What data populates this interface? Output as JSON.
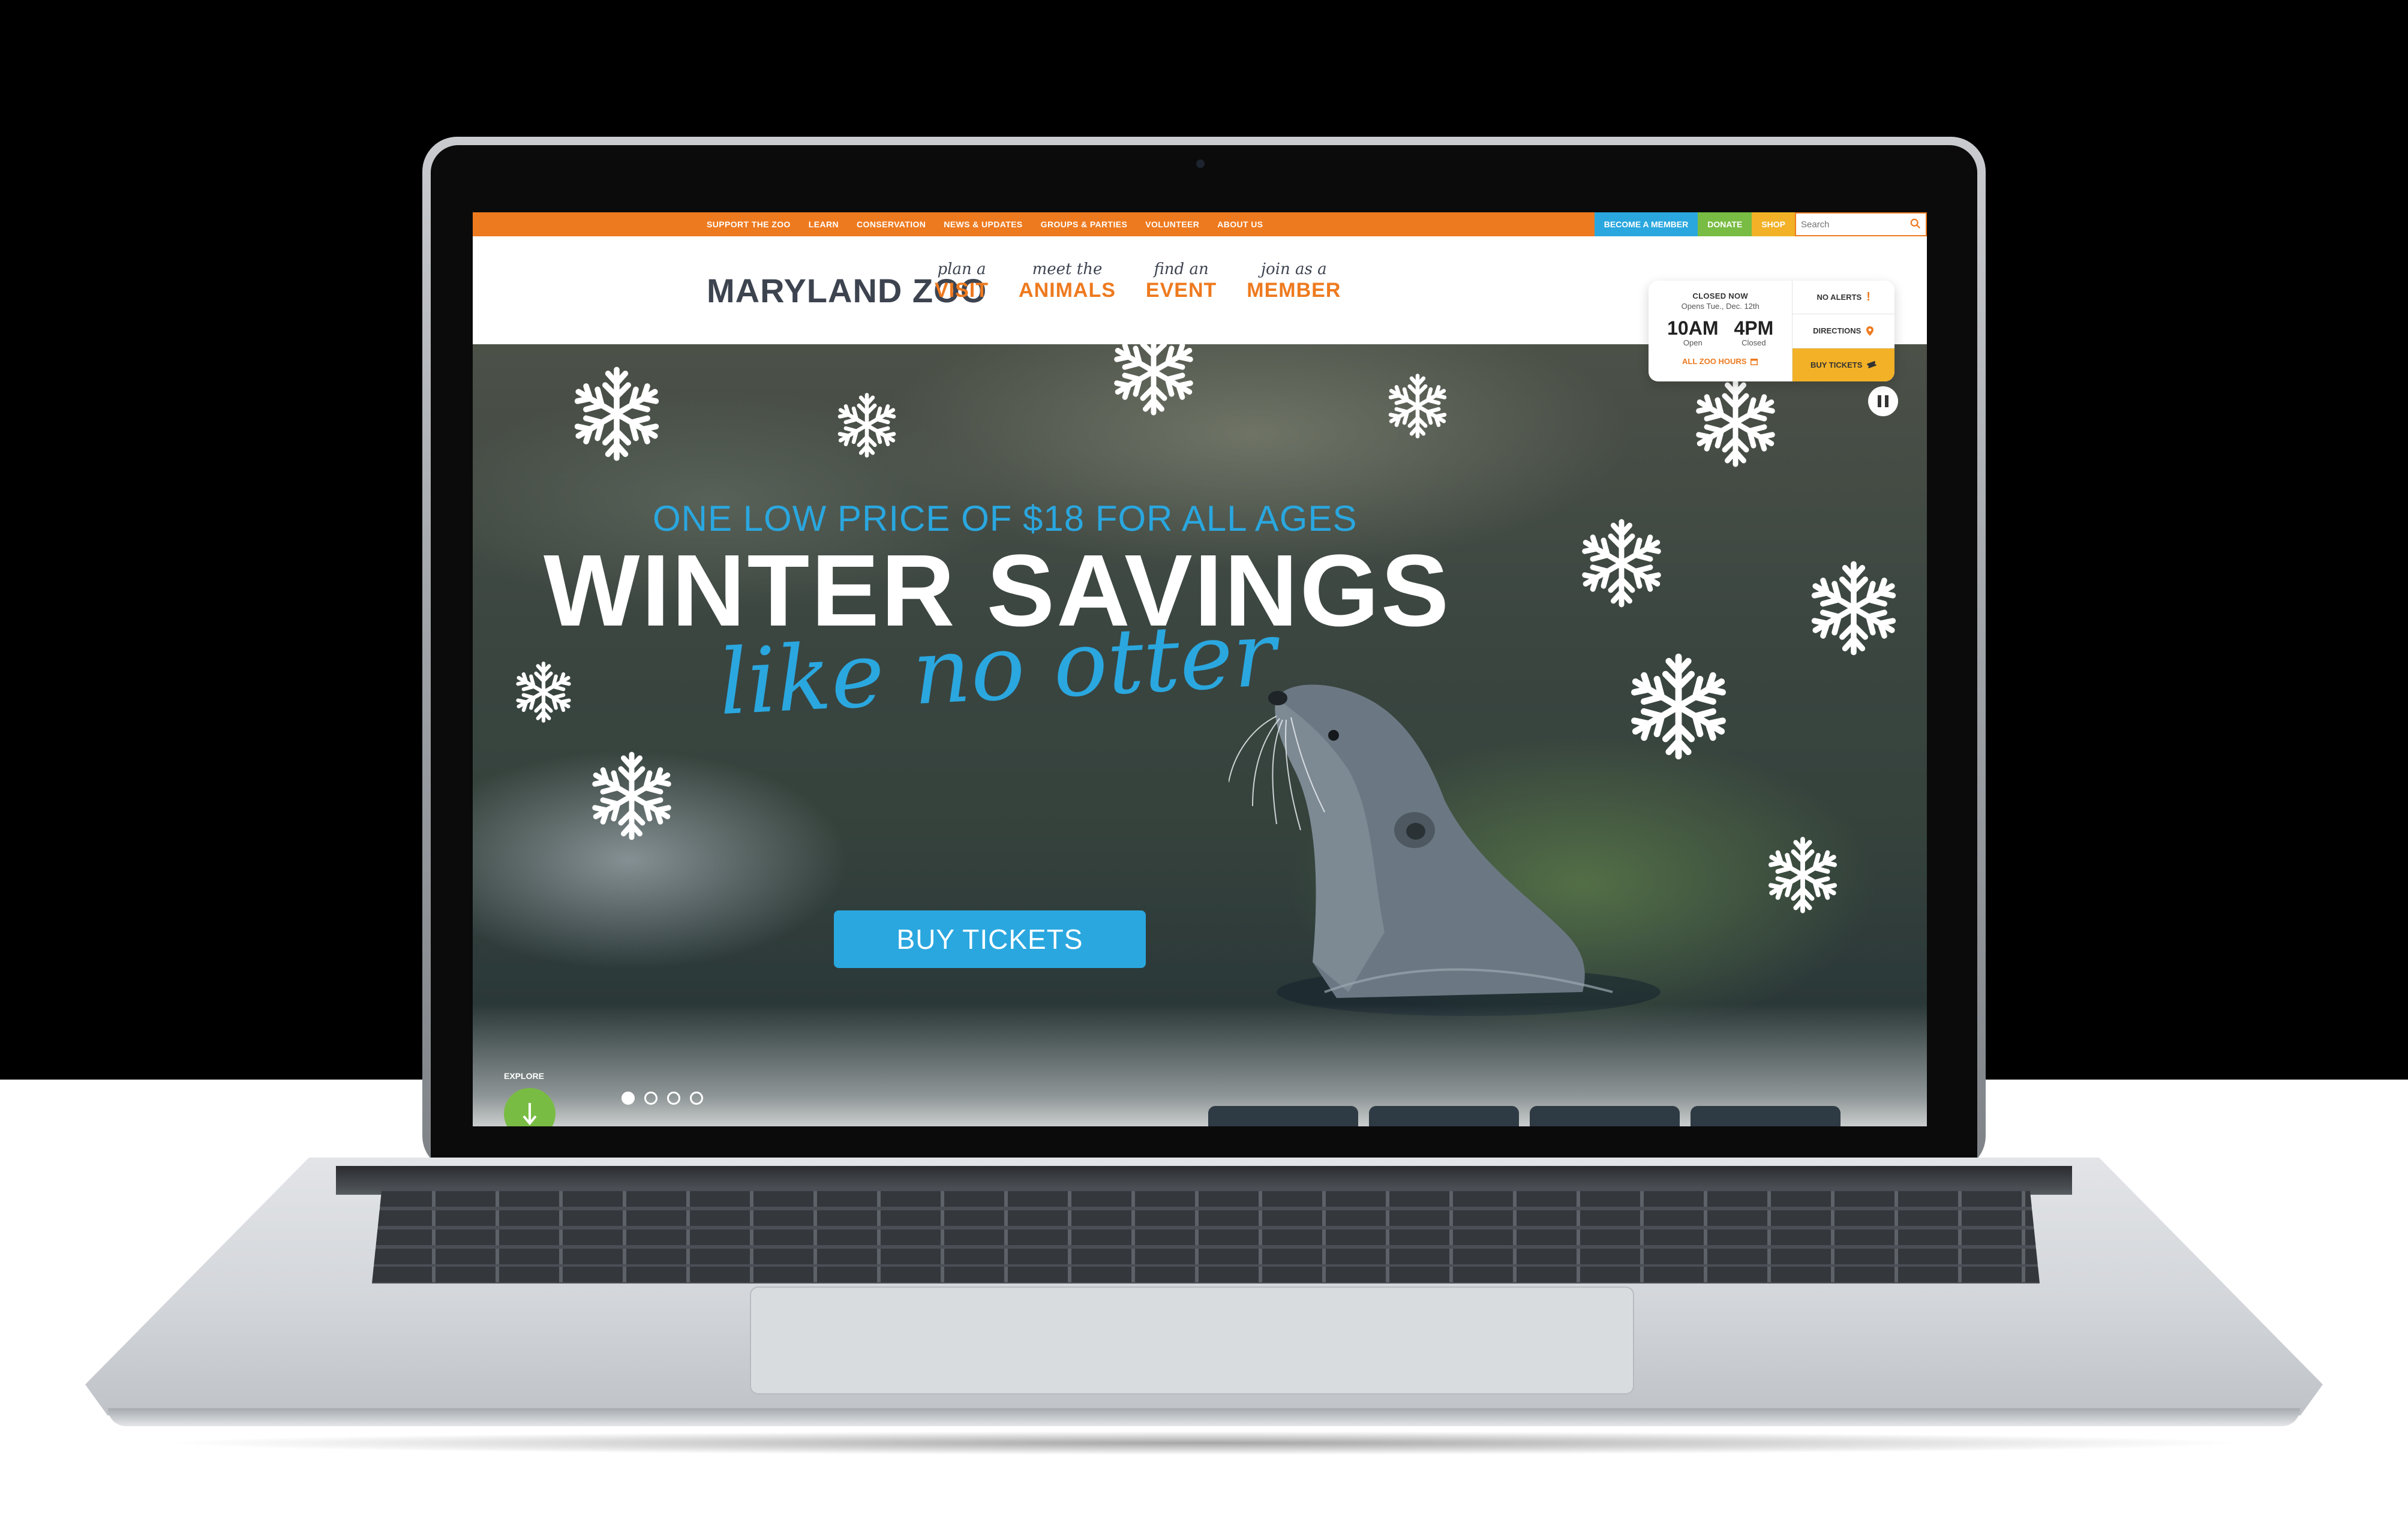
{
  "utility_nav": {
    "links": [
      "SUPPORT THE ZOO",
      "LEARN",
      "CONSERVATION",
      "NEWS & UPDATES",
      "GROUPS & PARTIES",
      "VOLUNTEER",
      "ABOUT US"
    ],
    "become_member": "BECOME A MEMBER",
    "donate": "DONATE",
    "shop": "SHOP",
    "search_placeholder": "Search"
  },
  "header": {
    "logo": "MARYLAND ZOO",
    "nav": [
      {
        "script": "plan a",
        "label": "VISIT"
      },
      {
        "script": "meet the",
        "label": "ANIMALS"
      },
      {
        "script": "find an",
        "label": "EVENT"
      },
      {
        "script": "join as a",
        "label": "MEMBER"
      }
    ]
  },
  "info_card": {
    "status": "CLOSED NOW",
    "opens": "Opens Tue., Dec. 12th",
    "open_time": "10AM",
    "open_label": "Open",
    "close_time": "4PM",
    "close_label": "Closed",
    "all_hours": "ALL ZOO HOURS",
    "alerts": "NO ALERTS",
    "alerts_mark": "!",
    "directions": "DIRECTIONS",
    "buy_tickets": "BUY TICKETS"
  },
  "hero": {
    "subhead": "ONE LOW PRICE OF $18 FOR ALL AGES",
    "headline": "WINTER SAVINGS",
    "script": "like no otter",
    "cta": "BUY TICKETS",
    "explore": "EXPLORE",
    "slides": 4,
    "active_slide": 1
  },
  "colors": {
    "orange": "#ee7a1f",
    "blue": "#2aa7df",
    "green": "#79bc43",
    "yellow": "#f2b126",
    "slate": "#3d4450"
  }
}
